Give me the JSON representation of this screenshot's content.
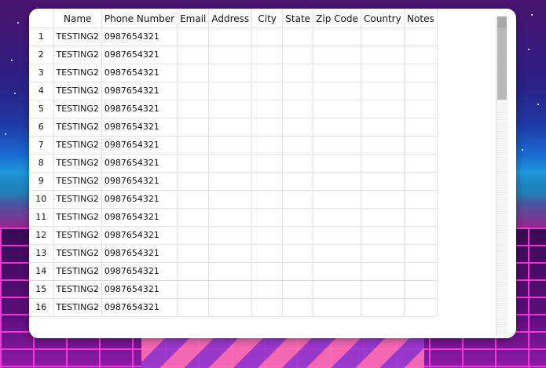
{
  "table": {
    "columns": [
      "Name",
      "Phone Number",
      "Email",
      "Address",
      "City",
      "State",
      "Zip Code",
      "Country",
      "Notes"
    ],
    "sort_indicator": "ˇ",
    "rows": [
      {
        "num": "1",
        "name": "TESTING2",
        "phone": "0987654321"
      },
      {
        "num": "2",
        "name": "TESTING2",
        "phone": "0987654321"
      },
      {
        "num": "3",
        "name": "TESTING2",
        "phone": "0987654321"
      },
      {
        "num": "4",
        "name": "TESTING2",
        "phone": "0987654321"
      },
      {
        "num": "5",
        "name": "TESTING2",
        "phone": "0987654321"
      },
      {
        "num": "6",
        "name": "TESTING2",
        "phone": "0987654321"
      },
      {
        "num": "7",
        "name": "TESTING2",
        "phone": "0987654321"
      },
      {
        "num": "8",
        "name": "TESTING2",
        "phone": "0987654321"
      },
      {
        "num": "9",
        "name": "TESTING2",
        "phone": "0987654321"
      },
      {
        "num": "10",
        "name": "TESTING2",
        "phone": "0987654321"
      },
      {
        "num": "11",
        "name": "TESTING2",
        "phone": "0987654321"
      },
      {
        "num": "12",
        "name": "TESTING2",
        "phone": "0987654321"
      },
      {
        "num": "13",
        "name": "TESTING2",
        "phone": "0987654321"
      },
      {
        "num": "14",
        "name": "TESTING2",
        "phone": "0987654321"
      },
      {
        "num": "15",
        "name": "TESTING2",
        "phone": "0987654321"
      },
      {
        "num": "16",
        "name": "TESTING2",
        "phone": "0987654321"
      }
    ]
  },
  "colors": {
    "window_bg": "#ffffff",
    "grid_line": "#e2e2e2",
    "scroll_thumb": "#b8b8b8"
  }
}
